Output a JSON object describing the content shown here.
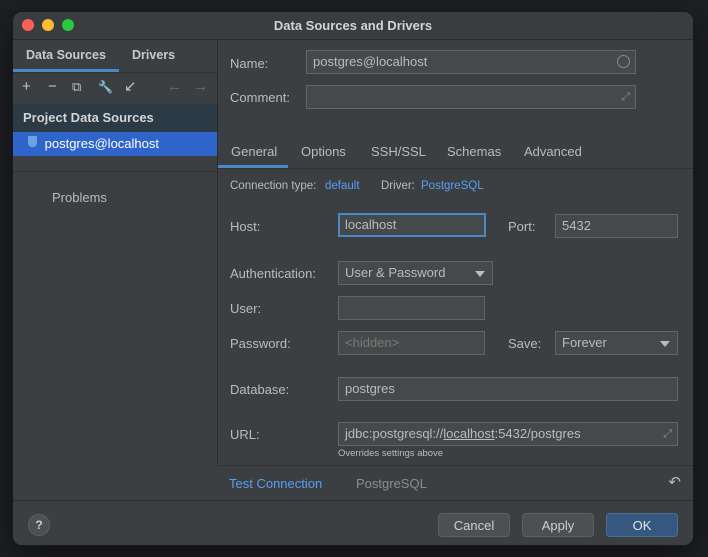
{
  "window": {
    "title": "Data Sources and Drivers"
  },
  "sidebar": {
    "tabs": [
      "Data Sources",
      "Drivers"
    ],
    "toolbar": [
      "+",
      "−",
      "⧉",
      "🔧",
      "↙",
      "←",
      "→"
    ],
    "section_header": "Project Data Sources",
    "selected_item": "postgres@localhost",
    "problems": "Problems"
  },
  "form": {
    "name_label": "Name:",
    "name_value": "postgres@localhost",
    "comment_label": "Comment:",
    "comment_value": "",
    "tabs": [
      "General",
      "Options",
      "SSH/SSL",
      "Schemas",
      "Advanced"
    ],
    "active_tab": "General",
    "connection_type_label": "Connection type:",
    "connection_type_value": "default",
    "driver_label": "Driver:",
    "driver_value": "PostgreSQL",
    "host_label": "Host:",
    "host_value": "localhost",
    "port_label": "Port:",
    "port_value": "5432",
    "auth_label": "Authentication:",
    "auth_value": "User & Password",
    "user_label": "User:",
    "user_value": "",
    "password_label": "Password:",
    "password_placeholder": "<hidden>",
    "save_label": "Save:",
    "save_value": "Forever",
    "database_label": "Database:",
    "database_value": "postgres",
    "url_label": "URL:",
    "url_prefix": "jdbc:postgresql://",
    "url_host": "localhost",
    "url_suffix": ":5432/postgres",
    "url_hint": "Overrides settings above"
  },
  "bottom": {
    "test_connection": "Test Connection",
    "driver_name": "PostgreSQL"
  },
  "footer": {
    "help": "?",
    "cancel": "Cancel",
    "apply": "Apply",
    "ok": "OK"
  },
  "colors": {
    "accent": "#4a88c7",
    "selection": "#2f65ca",
    "link": "#589df6",
    "background": "#3c3f41"
  }
}
